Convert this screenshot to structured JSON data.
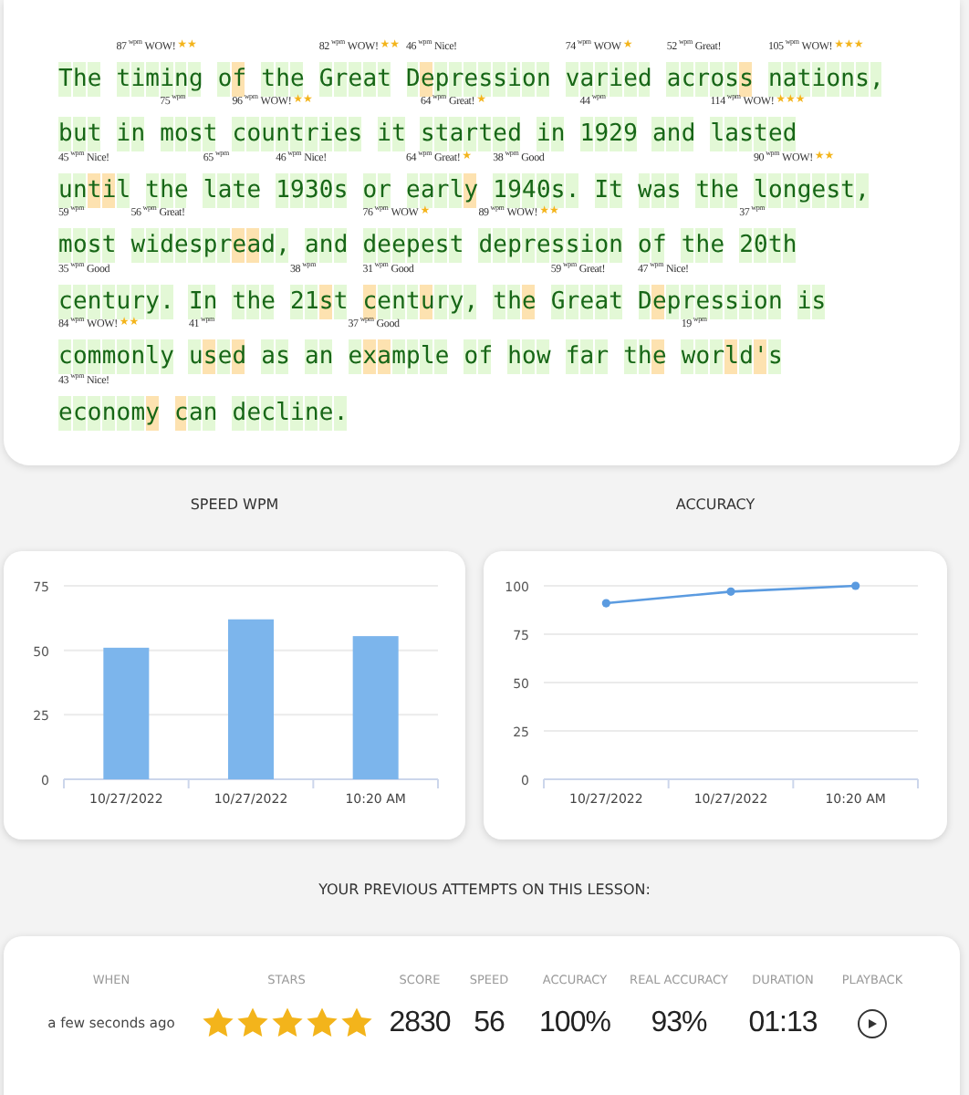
{
  "passage": {
    "lines": [
      {
        "words": [
          {
            "text": "The"
          },
          {
            "text": "timing",
            "wpm": "87",
            "unit": "wpm",
            "rating": "WOW!",
            "badge": "★★"
          },
          {
            "parts": [
              {
                "text": "o",
                "error": false
              },
              {
                "text": "f",
                "error": true
              }
            ]
          },
          {
            "text": "the"
          },
          {
            "text": "Great",
            "wpm": "82",
            "unit": "wpm",
            "rating": "WOW!",
            "badge": "★★"
          },
          {
            "parts": [
              {
                "text": "D",
                "error": false
              },
              {
                "text": "e",
                "error": true
              },
              {
                "text": "pression",
                "error": false
              }
            ],
            "wpm": "46",
            "unit": "wpm",
            "rating": "Nice!"
          },
          {
            "text": "varied",
            "wpm": "74",
            "unit": "wpm",
            "rating": "WOW",
            "badge": "★"
          },
          {
            "parts": [
              {
                "text": "acros",
                "error": false
              },
              {
                "text": "s",
                "error": true
              }
            ],
            "wpm": "52",
            "unit": "wpm",
            "rating": "Great!"
          },
          {
            "text": "nations,",
            "wpm": "105",
            "unit": "wpm",
            "rating": "WOW!",
            "badge": "★★★"
          }
        ]
      },
      {
        "words": [
          {
            "text": "but"
          },
          {
            "text": "in"
          },
          {
            "text": "most",
            "wpm": "75",
            "unit": "wpm"
          },
          {
            "text": "countries",
            "wpm": "96",
            "unit": "wpm",
            "rating": "WOW!",
            "badge": "★★"
          },
          {
            "text": "it"
          },
          {
            "text": "started",
            "wpm": "64",
            "unit": "wpm",
            "rating": "Great!",
            "badge": "★"
          },
          {
            "text": "in"
          },
          {
            "text": "1929",
            "wpm": "44",
            "unit": "wpm"
          },
          {
            "text": "and"
          },
          {
            "text": "lasted",
            "wpm": "114",
            "unit": "wpm",
            "rating": "WOW!",
            "badge": "★★★"
          }
        ]
      },
      {
        "words": [
          {
            "parts": [
              {
                "text": "un",
                "error": false
              },
              {
                "text": "ti",
                "error": true
              },
              {
                "text": "l",
                "error": false
              }
            ],
            "wpm": "45",
            "unit": "wpm",
            "rating": "Nice!"
          },
          {
            "text": "the"
          },
          {
            "text": "late",
            "wpm": "65",
            "unit": "wpm"
          },
          {
            "text": "1930s",
            "wpm": "46",
            "unit": "wpm",
            "rating": "Nice!"
          },
          {
            "text": "or"
          },
          {
            "parts": [
              {
                "text": "earl",
                "error": false
              },
              {
                "text": "y",
                "error": true
              }
            ],
            "wpm": "64",
            "unit": "wpm",
            "rating": "Great!",
            "badge": "★"
          },
          {
            "text": "1940s.",
            "wpm": "38",
            "unit": "wpm",
            "rating": "Good"
          },
          {
            "text": "It"
          },
          {
            "text": "was"
          },
          {
            "text": "the"
          },
          {
            "text": "longest,",
            "wpm": "90",
            "unit": "wpm",
            "rating": "WOW!",
            "badge": "★★"
          }
        ]
      },
      {
        "words": [
          {
            "text": "most",
            "wpm": "59",
            "unit": "wpm"
          },
          {
            "parts": [
              {
                "text": "widespr",
                "error": false
              },
              {
                "text": "ea",
                "error": true
              },
              {
                "text": "d,",
                "error": false
              }
            ],
            "wpm": "56",
            "unit": "wpm",
            "rating": "Great!"
          },
          {
            "text": "and"
          },
          {
            "text": "deepest",
            "wpm": "76",
            "unit": "wpm",
            "rating": "WOW",
            "badge": "★"
          },
          {
            "text": "depression",
            "wpm": "89",
            "unit": "wpm",
            "rating": "WOW!",
            "badge": "★★"
          },
          {
            "text": "of"
          },
          {
            "text": "the"
          },
          {
            "text": "20th",
            "wpm": "37",
            "unit": "wpm"
          }
        ]
      },
      {
        "words": [
          {
            "text": "century.",
            "wpm": "35",
            "unit": "wpm",
            "rating": "Good"
          },
          {
            "text": "In"
          },
          {
            "text": "the"
          },
          {
            "parts": [
              {
                "text": "21",
                "error": false
              },
              {
                "text": "s",
                "error": true
              },
              {
                "text": "t",
                "error": false
              }
            ],
            "wpm": "38",
            "unit": "wpm"
          },
          {
            "parts": [
              {
                "text": "c",
                "error": true
              },
              {
                "text": "ent",
                "error": false
              },
              {
                "text": "u",
                "error": true
              },
              {
                "text": "ry,",
                "error": false
              }
            ],
            "wpm": "31",
            "unit": "wpm",
            "rating": "Good"
          },
          {
            "parts": [
              {
                "text": "th",
                "error": false
              },
              {
                "text": "e",
                "error": true
              }
            ]
          },
          {
            "text": "Great",
            "wpm": "59",
            "unit": "wpm",
            "rating": "Great!"
          },
          {
            "parts": [
              {
                "text": "D",
                "error": false
              },
              {
                "text": "e",
                "error": true
              },
              {
                "text": "pression",
                "error": false
              }
            ],
            "wpm": "47",
            "unit": "wpm",
            "rating": "Nice!"
          },
          {
            "text": "is"
          }
        ]
      },
      {
        "words": [
          {
            "text": "commonly",
            "wpm": "84",
            "unit": "wpm",
            "rating": "WOW!",
            "badge": "★★"
          },
          {
            "parts": [
              {
                "text": "u",
                "error": false
              },
              {
                "text": "s",
                "error": true
              },
              {
                "text": "e",
                "error": false
              },
              {
                "text": "d",
                "error": true
              }
            ],
            "wpm": "41",
            "unit": "wpm"
          },
          {
            "text": "as"
          },
          {
            "text": "an"
          },
          {
            "parts": [
              {
                "text": "e",
                "error": false
              },
              {
                "text": "xa",
                "error": true
              },
              {
                "text": "mple",
                "error": false
              }
            ],
            "wpm": "37",
            "unit": "wpm",
            "rating": "Good"
          },
          {
            "text": "of"
          },
          {
            "text": "how"
          },
          {
            "text": "far"
          },
          {
            "parts": [
              {
                "text": "th",
                "error": false
              },
              {
                "text": "e",
                "error": true
              }
            ]
          },
          {
            "parts": [
              {
                "text": "wor",
                "error": false
              },
              {
                "text": "l",
                "error": true
              },
              {
                "text": "d",
                "error": false
              },
              {
                "text": "'",
                "error": true
              },
              {
                "text": "s",
                "error": false
              }
            ],
            "wpm": "19",
            "unit": "wpm"
          }
        ]
      },
      {
        "words": [
          {
            "parts": [
              {
                "text": "econom",
                "error": false
              },
              {
                "text": "y",
                "error": true
              }
            ],
            "wpm": "43",
            "unit": "wpm",
            "rating": "Nice!"
          },
          {
            "parts": [
              {
                "text": "c",
                "error": true
              },
              {
                "text": "an",
                "error": false
              }
            ]
          },
          {
            "text": "decline."
          }
        ]
      }
    ]
  },
  "charts": [
    {
      "heading": "SPEED WPM",
      "chart_data": {
        "type": "bar",
        "categories": [
          "10/27/2022",
          "10/27/2022",
          "10:20 AM"
        ],
        "series": [
          {
            "color": "#7cb5ec",
            "values": [
              51,
              62,
              55.5
            ]
          }
        ],
        "ylim": [
          0,
          75
        ],
        "yticks": [
          0,
          25,
          50,
          75
        ],
        "grid": true
      }
    },
    {
      "heading": "ACCURACY",
      "chart_data": {
        "type": "line",
        "categories": [
          "10/27/2022",
          "10/27/2022",
          "10:20 AM"
        ],
        "series": [
          {
            "color": "#5b9be0",
            "values": [
              91,
              97,
              100
            ],
            "marker": true
          }
        ],
        "ylim": [
          0,
          100
        ],
        "yticks": [
          0,
          25,
          50,
          75,
          100
        ],
        "grid": true
      }
    }
  ],
  "attempts": {
    "title": "YOUR PREVIOUS ATTEMPTS ON THIS LESSON:",
    "columns": [
      "WHEN",
      "STARS",
      "SCORE",
      "SPEED",
      "ACCURACY",
      "REAL ACCURACY",
      "DURATION",
      "PLAYBACK"
    ],
    "rows": [
      {
        "when": "a few seconds ago",
        "stars": 5,
        "score": "2830",
        "speed": "56",
        "accuracy": "100%",
        "real_accuracy": "93%",
        "duration": "01:13"
      }
    ]
  }
}
